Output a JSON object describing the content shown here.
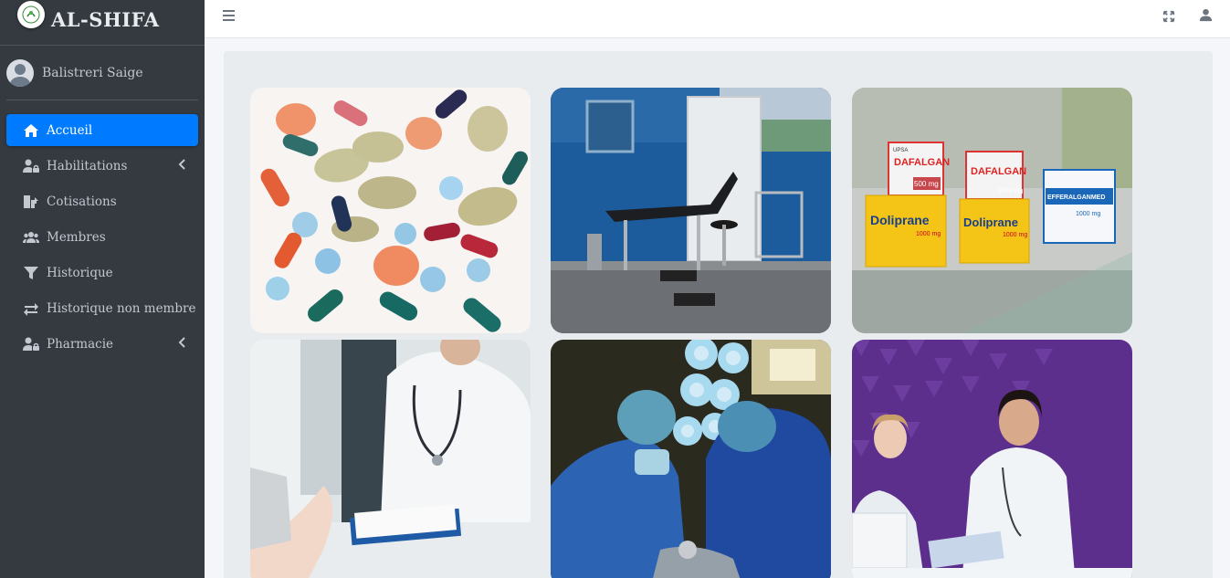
{
  "brand": {
    "name": "AL-SHIFA",
    "logo_icon": "logo-icon"
  },
  "user": {
    "name": "Balistreri Saige",
    "avatar_icon": "user-avatar-icon"
  },
  "sidebar": {
    "items": [
      {
        "label": "Accueil",
        "icon": "home-icon",
        "active": true
      },
      {
        "label": "Habilitations",
        "icon": "user-lock-icon",
        "has_submenu": true
      },
      {
        "label": "Cotisations",
        "icon": "cotisations-icon"
      },
      {
        "label": "Membres",
        "icon": "users-icon"
      },
      {
        "label": "Historique",
        "icon": "filter-icon"
      },
      {
        "label": "Historique non membre",
        "icon": "exchange-icon"
      },
      {
        "label": "Pharmacie",
        "icon": "user-lock-icon",
        "has_submenu": true
      }
    ]
  },
  "topbar": {
    "menu_icon": "hamburger-icon",
    "fullscreen_icon": "expand-icon",
    "user_icon": "user-icon"
  },
  "gallery": [
    {
      "name": "medicine-pills-image"
    },
    {
      "name": "examination-room-image"
    },
    {
      "name": "pharmacy-boxes-image",
      "texts": [
        "DAFALGAN",
        "DAFALGAN",
        "EFFERALGANMED",
        "Doliprane",
        "Doliprane",
        "UPSA",
        "500 mg",
        "1000 mg",
        "1000 mg",
        "1000 mg",
        "1000 mg"
      ]
    },
    {
      "name": "doctor-consultation-image"
    },
    {
      "name": "surgery-image"
    },
    {
      "name": "doctors-team-image"
    }
  ],
  "colors": {
    "sidebar_bg": "#343a40",
    "active_bg": "#007bff",
    "content_bg": "#e9ecef",
    "page_bg": "#f4f6f9"
  }
}
